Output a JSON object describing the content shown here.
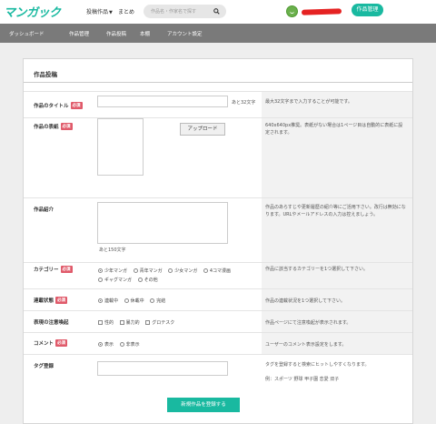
{
  "header": {
    "logo": "マンガック",
    "nav": [
      {
        "label": "投稿作品"
      },
      {
        "label": "まとめ"
      }
    ],
    "search_placeholder": "作品名・作家名で探す",
    "manage_button": "作品管理"
  },
  "subnav": [
    "ダッシュボード",
    "作品管理",
    "作品投稿",
    "本棚",
    "アカウント設定"
  ],
  "form": {
    "title": "作品投稿",
    "required_badge": "必須",
    "rows": {
      "title": {
        "label": "作品のタイトル",
        "counter": "あと32文字",
        "help": "最大32文字まで入力することが可能です。"
      },
      "cover": {
        "label": "作品の表紙",
        "upload": "アップロード",
        "help": "640x640px推奨。表紙がない場合は1ページ目は自動的に表紙に設定されます。"
      },
      "intro": {
        "label": "作品紹介",
        "counter": "あと150文字",
        "help": "作品のあらすじや更新履歴の紹介等にご活用下さい。改行は無効になります。URLやメールアドレスの入力は控えましょう。"
      },
      "category": {
        "label": "カテゴリー",
        "options": [
          "少年マンガ",
          "青年マンガ",
          "少女マンガ",
          "4コマ漫画",
          "ギャグマンガ",
          "その他"
        ],
        "help": "作品に該当するカテゴリーを1つ選択して下さい。"
      },
      "status": {
        "label": "連載状態",
        "options": [
          "連載中",
          "休載中",
          "完結"
        ],
        "help": "作品の連載状況を1つ選択して下さい。"
      },
      "warning": {
        "label": "表現の注意喚起",
        "options": [
          "性的",
          "暴力的",
          "グロテスク"
        ],
        "help": "作品ページにて注意喚起が表示されます。"
      },
      "comment": {
        "label": "コメント",
        "options": [
          "表示",
          "非表示"
        ],
        "help": "ユーザーのコメント表示設定をします。"
      },
      "tags": {
        "label": "タグ登録",
        "help": "タグを登録すると検索にヒットしやすくなります。",
        "example": "例：スポーツ 野球 甲子園 恋愛 双子"
      }
    },
    "submit": "新規作品を登録する"
  }
}
